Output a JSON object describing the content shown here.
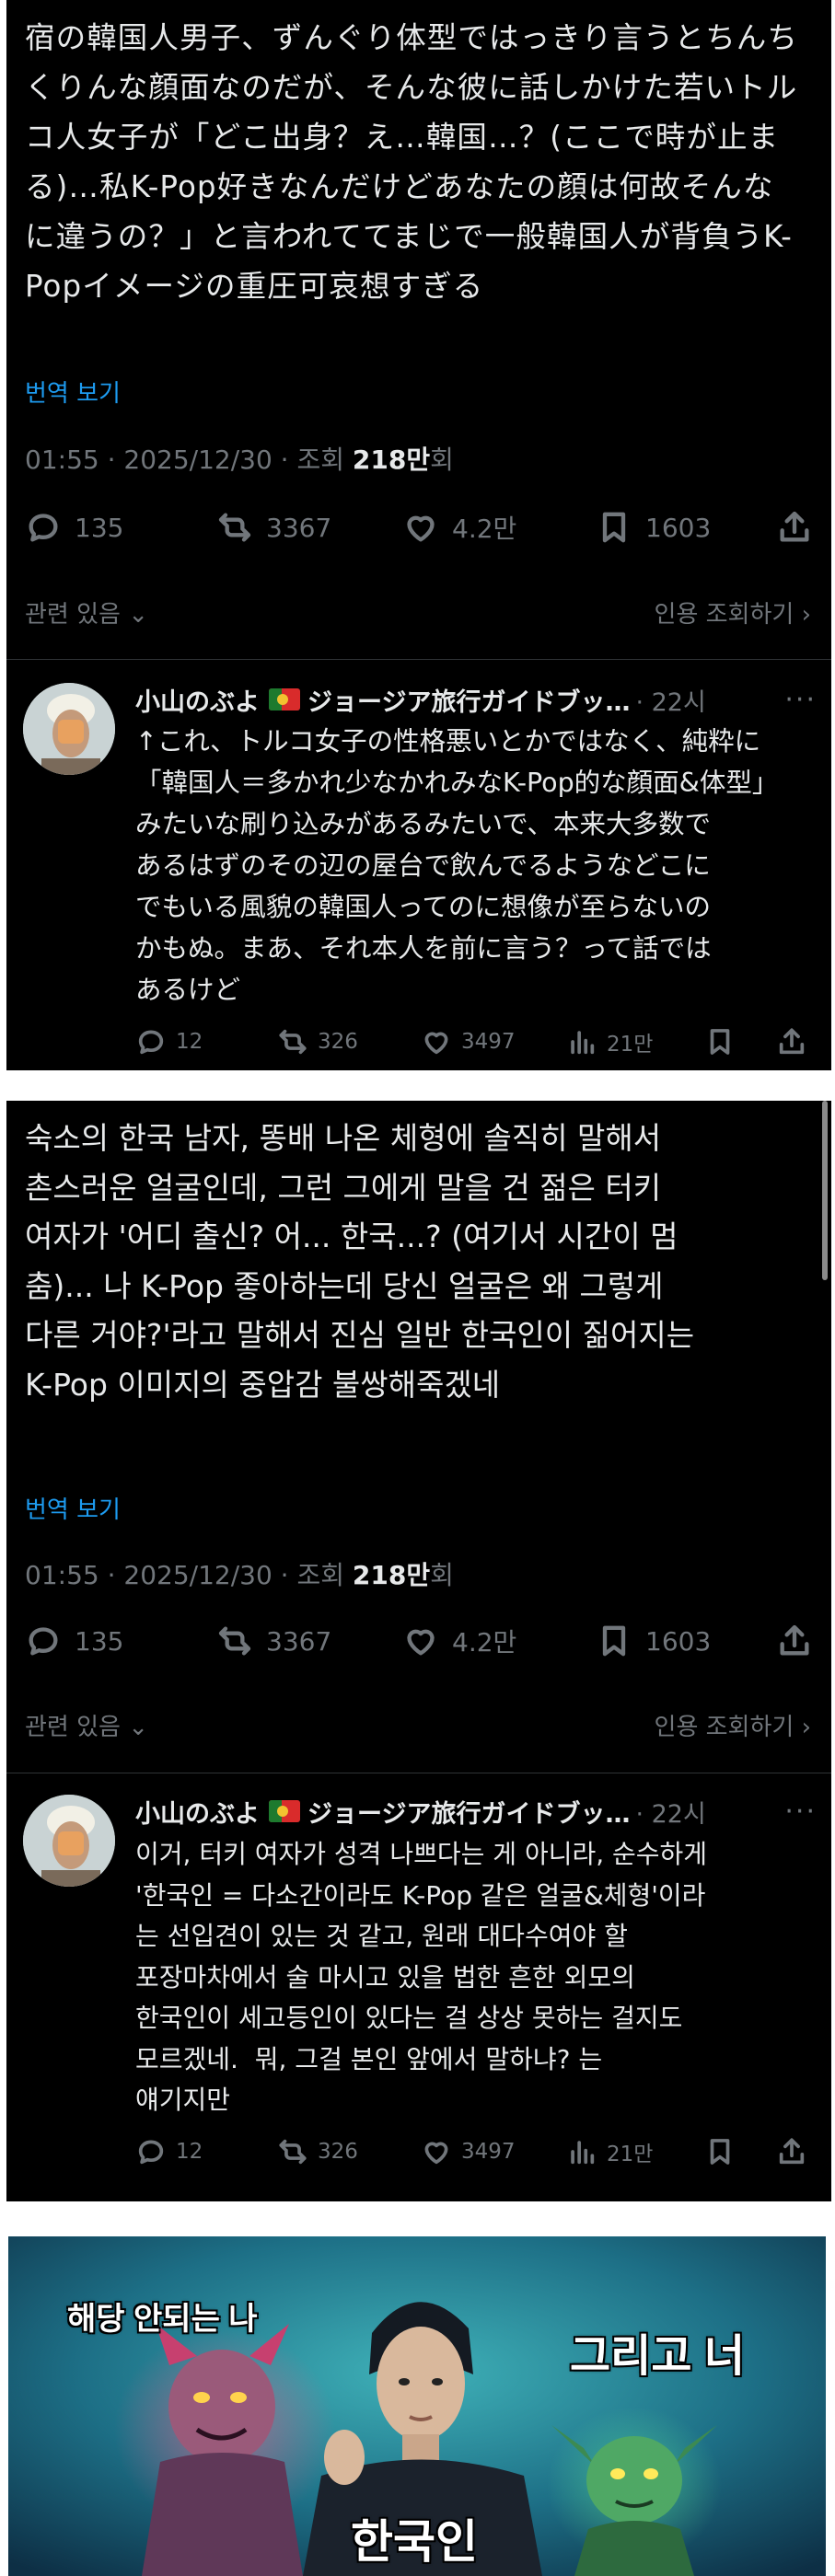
{
  "post1": {
    "text": "宿の韓国人男子、ずんぐり体型ではっきり言うとちんち\nくりんな顔面なのだが、そんな彼に話しかけた若いトル\nコ人女子が「どこ出身？え…韓国…？(ここで時が止ま\nる)…私K-Pop好きなんだけどあなたの顔は何故そんな\nに違うの？」と言われててまじで一般韓国人が背負うK-\nPopイメージの重圧可哀想すぎる",
    "translate_label": "번역 보기",
    "meta_prefix": "01:55 · 2025/12/30 · 조회 ",
    "meta_views": "218만",
    "meta_suffix": "회",
    "stats": {
      "replies": "135",
      "reposts": "3367",
      "likes": "4.2만",
      "bookmarks": "1603"
    },
    "related_label": "관련 있음",
    "quotes_label": "인용 조회하기"
  },
  "reply1": {
    "name": "小山のぶよ",
    "name_suffix": "ジョージア旅行ガイドブッ…",
    "time": "· 22시",
    "text": "↑これ、トルコ女子の性格悪いとかではなく、純粋に\n「韓国人＝多かれ少なかれみなK-Pop的な顔面&体型」\nみたいな刷り込みがあるみたいで、本来大多数で\nあるはずのその辺の屋台で飲んでるようなどこに\nでもいる風貌の韓国人ってのに想像が至らないの\nかもぬ。まあ、それ本人を前に言う？って話では\nあるけど",
    "stats": {
      "replies": "12",
      "reposts": "326",
      "likes": "3497",
      "views": "21만"
    }
  },
  "post2": {
    "text": "숙소의 한국 남자, 똥배 나온 체형에 솔직히 말해서\n촌스러운 얼굴인데, 그런 그에게 말을 건 젊은 터키\n여자가 '어디 출신? 어... 한국...? (여기서 시간이 멈\n춤)... 나 K-Pop 좋아하는데 당신 얼굴은 왜 그렇게\n다른 거야?'라고 말해서 진심 일반 한국인이 짊어지는\nK-Pop 이미지의 중압감 불쌍해죽겠네",
    "translate_label": "번역 보기",
    "meta_prefix": "01:55 · 2025/12/30 · 조회 ",
    "meta_views": "218만",
    "meta_suffix": "회",
    "stats": {
      "replies": "135",
      "reposts": "3367",
      "likes": "4.2만",
      "bookmarks": "1603"
    },
    "related_label": "관련 있음",
    "quotes_label": "인용 조회하기"
  },
  "reply2": {
    "name": "小山のぶよ",
    "name_suffix": "ジョージア旅行ガイドブッ…",
    "time": "· 22시",
    "text": "이거, 터키 여자가 성격 나쁘다는 게 아니라, 순수하게\n'한국인 = 다소간이라도 K-Pop 같은 얼굴&체형'이라\n는 선입견이 있는 것 같고, 원래 대다수여야 할\n포장마차에서 술 마시고 있을 법한 흔한 외모의\n한국인이 세고등인이 있다는 걸 상상 못하는 걸지도\n모르겠네.  뭐, 그걸 본인 앞에서 말하냐? 는\n얘기지만",
    "stats": {
      "replies": "12",
      "reposts": "326",
      "likes": "3497",
      "views": "21만"
    }
  },
  "meme": {
    "caption_left": "해당 안되는 나",
    "caption_right": "그리고 너",
    "caption_center": "한국인"
  },
  "colors": {
    "background": "#000000",
    "text": "#e7e9ea",
    "muted": "#71767b",
    "link": "#1d9bf0",
    "divider": "#2f3336"
  }
}
